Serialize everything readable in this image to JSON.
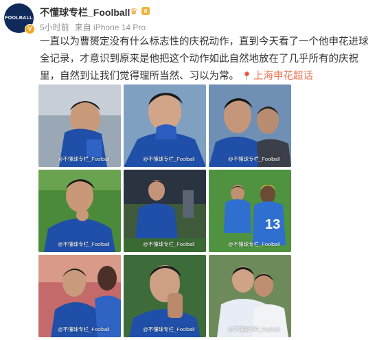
{
  "post": {
    "avatar_logo_text": "FOOLBALL",
    "verified_mark": "V",
    "username": "不懂球专栏_Foolball",
    "crown_icon": "crown-icon",
    "level_badge": "II",
    "time": "5小时前",
    "source": "来自 iPhone 14 Pro",
    "text": "一直以为曹赟定没有什么标志性的庆祝动作，直到今天看了一个他申花进球全记录，才意识到原来是他把这个动作如此自然地放在了几乎所有的庆祝里，自然到让我们觉得理所当然、习以为常。",
    "topic_icon": "location-pin-icon",
    "topic": "上海申花超话"
  },
  "images": [
    {
      "watermark": "@不懂球专栏_Foolball",
      "jersey_number": ""
    },
    {
      "watermark": "@不懂球专栏_Foolball",
      "jersey_number": ""
    },
    {
      "watermark": "@不懂球专栏_Foolball",
      "jersey_number": ""
    },
    {
      "watermark": "@不懂球专栏_Foolball",
      "jersey_number": ""
    },
    {
      "watermark": "@不懂球专栏_Foolball",
      "jersey_number": ""
    },
    {
      "watermark": "@不懂球专栏_Foolball",
      "jersey_number": "13"
    },
    {
      "watermark": "@不懂球专栏_Foolball",
      "jersey_number": ""
    },
    {
      "watermark": "@不懂球专栏_Foolball",
      "jersey_number": ""
    },
    {
      "watermark": "@不懂球专栏_Foolball",
      "jersey_number": ""
    }
  ],
  "colors": {
    "shenhua_blue": "#1f4fa8",
    "pitch_green": "#4a8a3a",
    "topic_orange": "#eb7350",
    "meta_gray": "#939393"
  }
}
